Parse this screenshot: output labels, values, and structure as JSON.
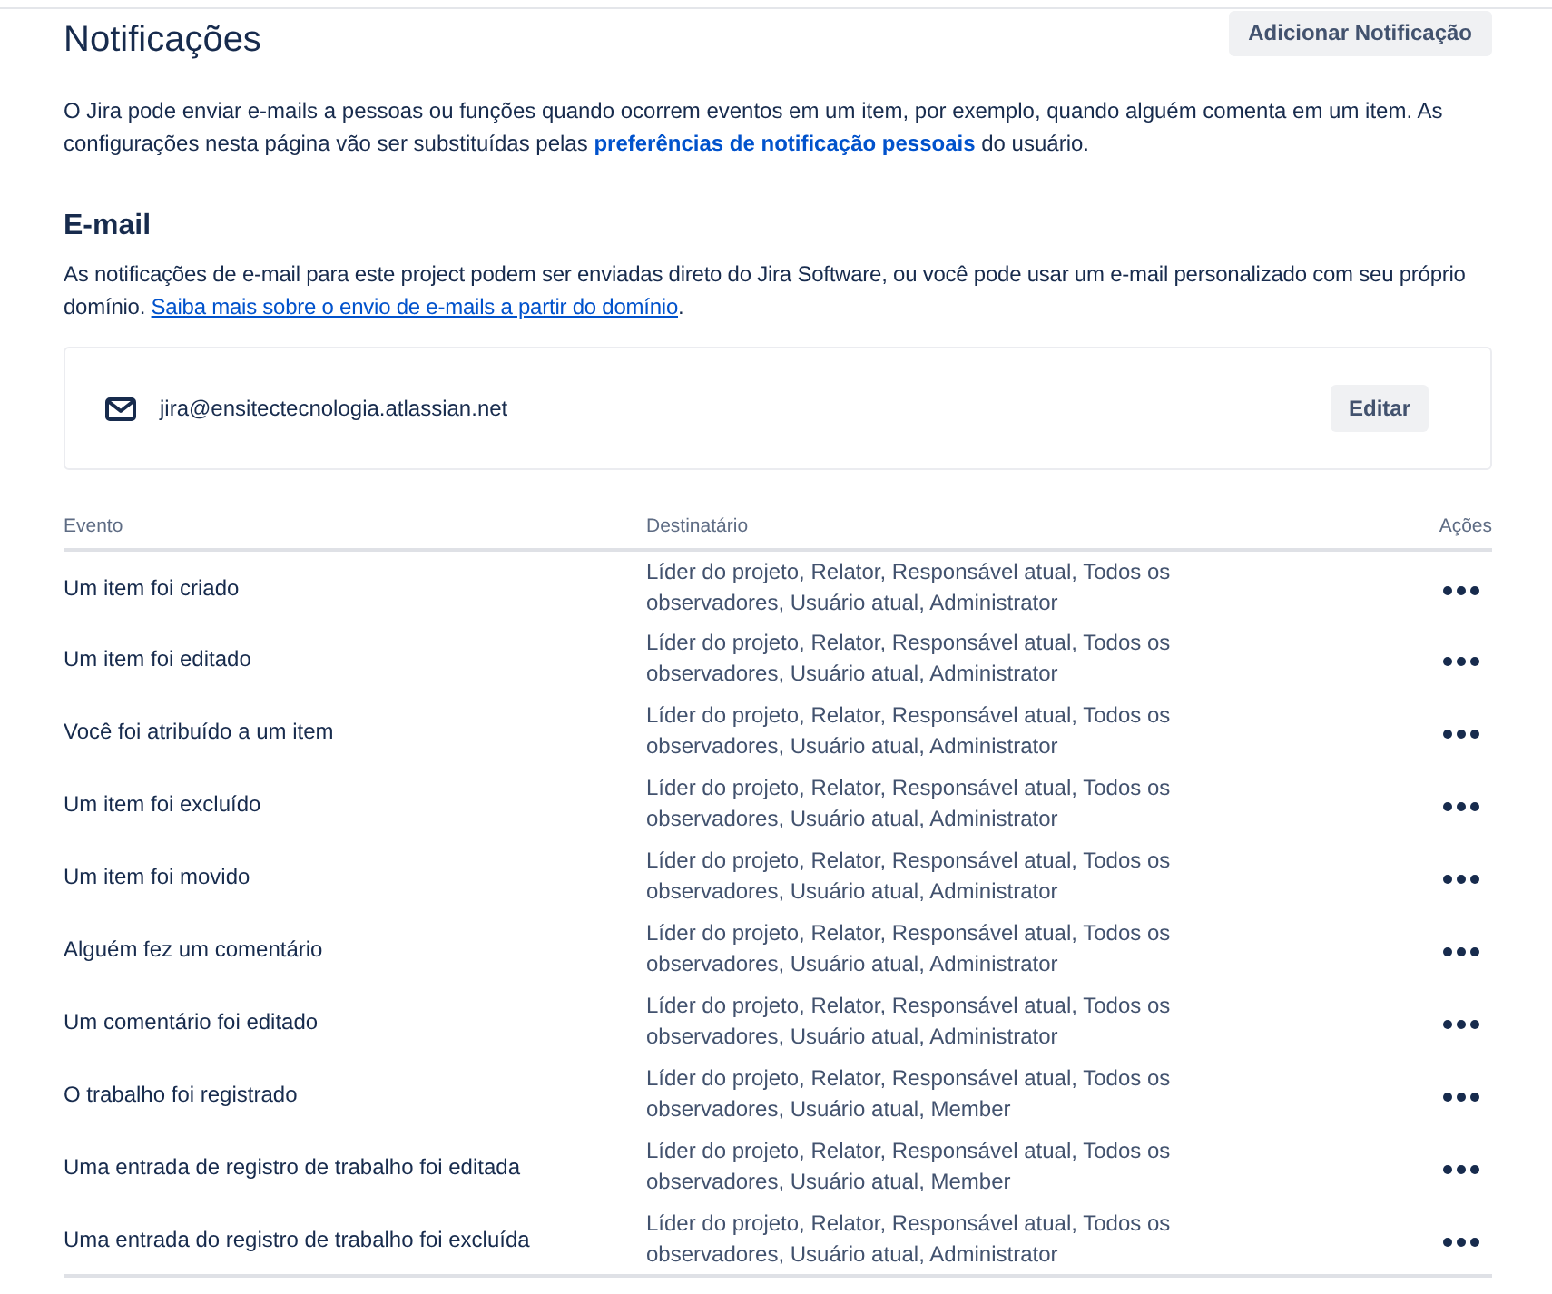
{
  "header": {
    "title": "Notificações",
    "button": "Adicionar Notificação"
  },
  "intro": {
    "text_before": "O Jira pode enviar e-mails a pessoas ou funções quando ocorrem eventos em um item, por exemplo, quando alguém comenta em um item. As configurações nesta página vão ser substituídas pelas ",
    "link": "preferências de notificação pessoais",
    "text_after": " do usuário."
  },
  "email_section": {
    "heading": "E-mail",
    "text_before": "As notificações de e-mail para este project podem ser enviadas direto do Jira Software, ou você pode usar um e-mail personalizado com seu próprio domínio. ",
    "link": "Saiba mais sobre o envio de e-mails a partir do domínio",
    "text_after": ".",
    "sender": {
      "address": "jira@ensitectecnologia.atlassian.net",
      "button": "Editar"
    }
  },
  "table": {
    "columns": [
      "Evento",
      "Destinatário",
      "Ações"
    ],
    "rows": [
      {
        "event": "Um item foi criado",
        "recipients": "Líder do projeto, Relator, Responsável atual, Todos os observadores, Usuário atual, Administrator"
      },
      {
        "event": "Um item foi editado",
        "recipients": "Líder do projeto, Relator, Responsável atual, Todos os observadores, Usuário atual, Administrator"
      },
      {
        "event": "Você foi atribuído a um item",
        "recipients": "Líder do projeto, Relator, Responsável atual, Todos os observadores, Usuário atual, Administrator"
      },
      {
        "event": "Um item foi excluído",
        "recipients": "Líder do projeto, Relator, Responsável atual, Todos os observadores, Usuário atual, Administrator"
      },
      {
        "event": "Um item foi movido",
        "recipients": "Líder do projeto, Relator, Responsável atual, Todos os observadores, Usuário atual, Administrator"
      },
      {
        "event": "Alguém fez um comentário",
        "recipients": "Líder do projeto, Relator, Responsável atual, Todos os observadores, Usuário atual, Administrator"
      },
      {
        "event": "Um comentário foi editado",
        "recipients": "Líder do projeto, Relator, Responsável atual, Todos os observadores, Usuário atual, Administrator"
      },
      {
        "event": "O trabalho foi registrado",
        "recipients": "Líder do projeto, Relator, Responsável atual, Todos os observadores, Usuário atual, Member"
      },
      {
        "event": "Uma entrada de registro de trabalho foi editada",
        "recipients": "Líder do projeto, Relator, Responsável atual, Todos os observadores, Usuário atual, Member"
      },
      {
        "event": "Uma entrada do registro de trabalho foi excluída",
        "recipients": "Líder do projeto, Relator, Responsável atual, Todos os observadores, Usuário atual, Administrator"
      }
    ]
  }
}
